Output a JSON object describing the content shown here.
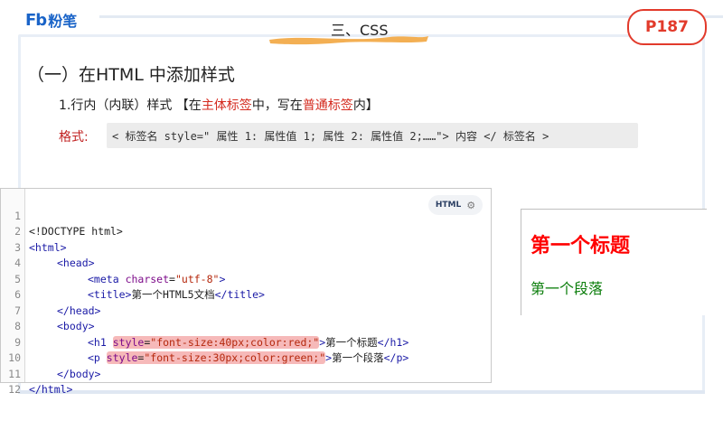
{
  "brand": {
    "mark": "Fb",
    "name": "粉笔"
  },
  "section_title": "三、CSS",
  "page_badge": "P187",
  "heading": "（一）在HTML 中添加样式",
  "subline": {
    "prefix": "1.行内（内联）样式 【在",
    "red1": "主体标签",
    "mid": "中，写在",
    "red2": "普通标签",
    "suffix": "内】"
  },
  "format": {
    "label": "格式:",
    "syntax": "< 标签名 style=\" 属性 1: 属性值 1; 属性 2: 属性值 2;……\"> 内容 </ 标签名 >"
  },
  "code_panel": {
    "badge_label": "HTML",
    "line_numbers": [
      "1",
      "2",
      "3",
      "4",
      "5",
      "6",
      "7",
      "8",
      "9",
      "10",
      "11",
      "12"
    ],
    "lines": {
      "l1": "<!DOCTYPE html>",
      "l2": "<html>",
      "l3": "<head>",
      "l4_tag": "<meta",
      "l4_attr": "charset",
      "l4_eq": "=",
      "l4_val": "\"utf-8\"",
      "l4_end": ">",
      "l5_open": "<title>",
      "l5_text": "第一个HTML5文档",
      "l5_close": "</title>",
      "l6": "</head>",
      "l7": "<body>",
      "l8_open": "<h1",
      "l8_attr": "style",
      "l8_eq": "=",
      "l8_val": "\"font-size:40px;color:red;\"",
      "l8_gt": ">",
      "l8_text": "第一个标题",
      "l8_close": "</h1>",
      "l9_open": "<p",
      "l9_attr": "style",
      "l9_eq": "=",
      "l9_val": "\"font-size:30px;color:green;\"",
      "l9_gt": ">",
      "l9_text": "第一个段落",
      "l9_close": "</p>",
      "l10": "</body>",
      "l11": "</html>",
      "l12": ""
    }
  },
  "preview": {
    "h1": "第一个标题",
    "p": "第一个段落"
  },
  "colors": {
    "accent_blue": "#1a64c8",
    "badge_red": "#e23a2b",
    "highlight": "#f6b9b9",
    "brush_orange": "#f2a640"
  }
}
